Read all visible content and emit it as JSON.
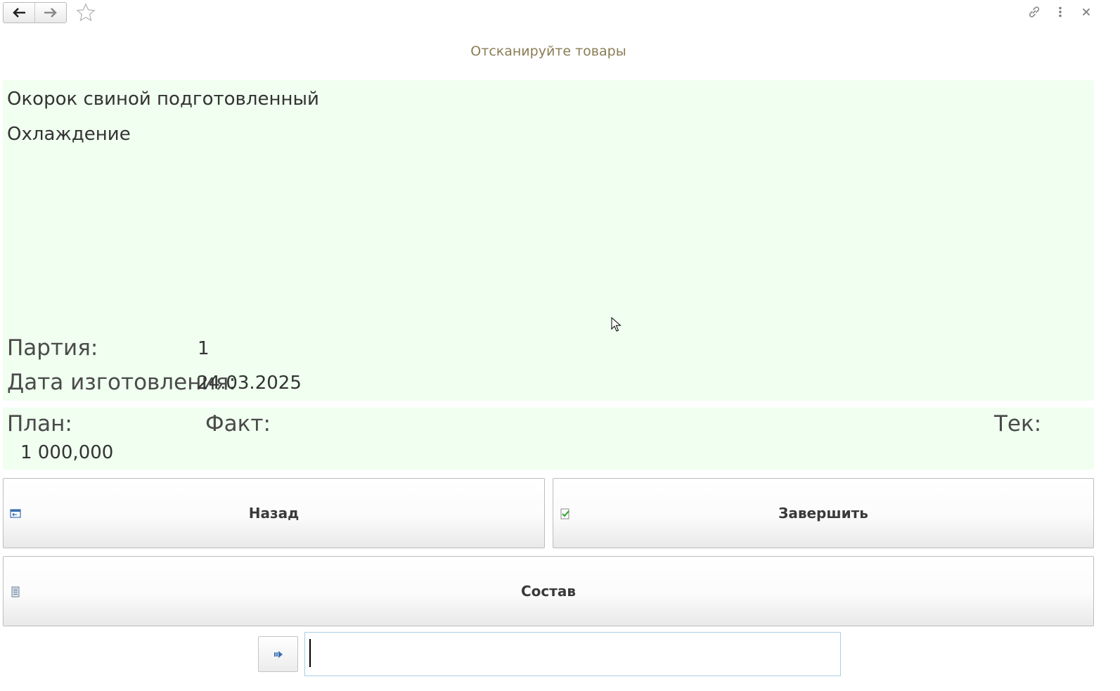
{
  "toolbar": {
    "back_icon": "arrow-left-icon",
    "forward_icon": "arrow-right-icon",
    "favorite_icon": "star-icon",
    "link_icon": "link-icon",
    "more_icon": "more-vertical-icon",
    "close_icon": "close-icon"
  },
  "form": {
    "title": "Отсканируйте товары"
  },
  "product": {
    "name": "Окорок свиной подготовленный",
    "stage": "Охлаждение",
    "batch_label": "Партия:",
    "batch_value": "1",
    "date_label": "Дата изготовления:",
    "date_value": "24.03.2025"
  },
  "quantities": {
    "plan_label": "План:",
    "plan_value": "1 000,000",
    "fact_label": "Факт:",
    "fact_value": "",
    "current_label": "Тек:",
    "current_value": ""
  },
  "buttons": {
    "back_label": "Назад",
    "finish_label": "Завершить",
    "composition_label": "Состав"
  },
  "scan": {
    "input_value": "",
    "input_placeholder": ""
  },
  "colors": {
    "panel_bg": "#f0fff0",
    "title_color": "#8a7d55",
    "input_border": "#a9cde6"
  }
}
